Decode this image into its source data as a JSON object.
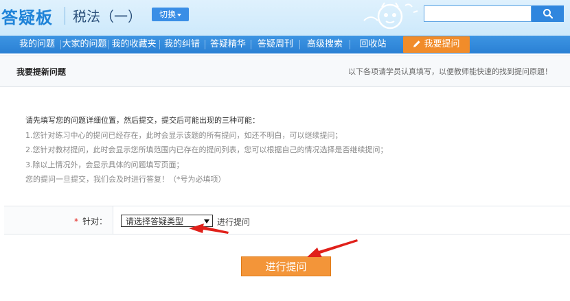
{
  "header": {
    "logo": "答疑板",
    "subject": "税法（一）",
    "switch_label": "切换",
    "search_placeholder": "",
    "search_icon": "search-icon"
  },
  "nav": {
    "items": [
      "我的问题",
      "大家的问题",
      "我的收藏夹",
      "我的纠错",
      "答疑精华",
      "答疑周刊",
      "高级搜索",
      "回收站"
    ],
    "ask_label": "我要提问",
    "ask_icon": "pencil-icon"
  },
  "panel": {
    "title": "我要提新问题",
    "hint": "以下各项请学员认真填写，以便教师能快速的找到提问原题！"
  },
  "notice": {
    "lines": [
      "请先填写您的问题详细位置，然后提交，提交后可能出现的三种可能：",
      "1.您针对练习中心的提问已经存在，此时会显示该题的所有提问，如还不明白，可以继续提问；",
      "2.您针对教材提问，此时会显示您所填范围内已存在的提问列表，您可以根据自己的情况选择是否继续提问；",
      "3.除以上情况外，会显示具体的问题填写页面；",
      "您的提问一旦提交，我们会及时进行答复！（*号为必填项）"
    ]
  },
  "form": {
    "required_mark": "*",
    "label": "针对：",
    "select_value": "请选择答疑类型",
    "suffix": "进行提问"
  },
  "submit_label": "进行提问",
  "colors": {
    "brand_blue": "#2a80d4",
    "accent_orange": "#f39539",
    "annotation_red": "#e0201a"
  }
}
